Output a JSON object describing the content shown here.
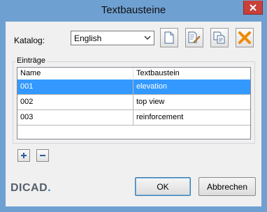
{
  "window": {
    "title": "Textbausteine"
  },
  "katalog": {
    "label": "Katalog:",
    "selected": "English"
  },
  "toolbar": {
    "icons": [
      "new-document-icon",
      "edit-document-icon",
      "copy-document-icon",
      "delete-x-icon"
    ]
  },
  "entries": {
    "group_label": "Einträge",
    "columns": [
      "Name",
      "Textbaustein"
    ],
    "rows": [
      {
        "name": "001",
        "text": "elevation",
        "selected": true
      },
      {
        "name": "002",
        "text": "top view",
        "selected": false
      },
      {
        "name": "003",
        "text": "reinforcement",
        "selected": false
      }
    ]
  },
  "row_buttons": {
    "add": "+",
    "remove": "−"
  },
  "footer": {
    "logo": "DICAD",
    "ok_label": "OK",
    "cancel_label": "Abbrechen"
  },
  "colors": {
    "frame": "#6fa0d2",
    "close": "#c8403a",
    "selection": "#3399ff",
    "delete_icon": "#f08a00"
  }
}
